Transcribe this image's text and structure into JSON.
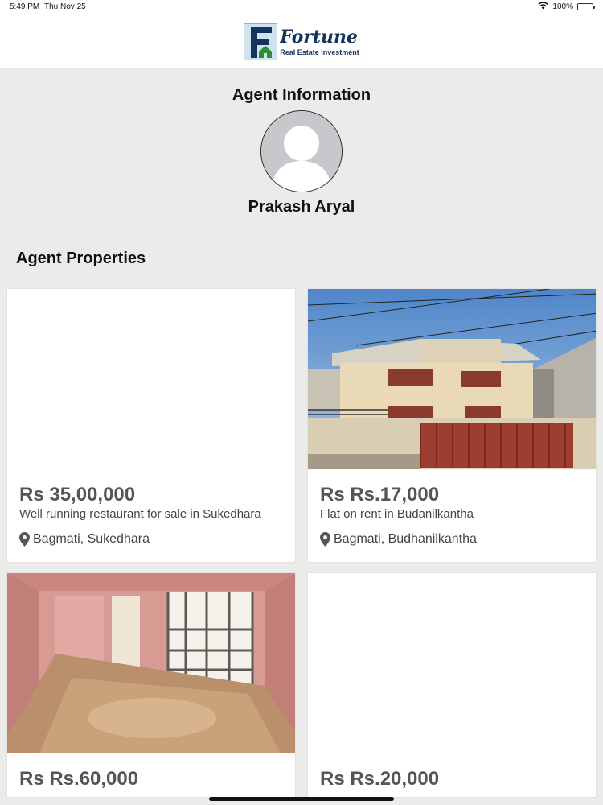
{
  "status_bar": {
    "time": "5:49 PM",
    "date": "Thu Nov 25",
    "battery": "100%",
    "battery_level": 1.0
  },
  "header": {
    "brand_name": "Fortune",
    "brand_tagline": "Real Estate Investment"
  },
  "agent": {
    "section_title": "Agent Information",
    "name": "Prakash Aryal"
  },
  "properties": {
    "section_title": "Agent Properties",
    "items": [
      {
        "price": "Rs 35,00,000",
        "title": "Well running restaurant for sale in Sukedhara",
        "location": "Bagmati, Sukedhara",
        "image": "blank"
      },
      {
        "price": "Rs Rs.17,000",
        "title": "Flat on rent in Budanilkantha",
        "location": "Bagmati, Budhanilkantha",
        "image": "house-photo"
      },
      {
        "price": "Rs Rs.60,000",
        "title": "",
        "location": "",
        "image": "room-photo"
      },
      {
        "price": "Rs Rs.20,000",
        "title": "",
        "location": "",
        "image": "blank"
      }
    ]
  },
  "colors": {
    "background": "#ebebea",
    "logo_navy": "#14345e",
    "logo_green": "#2f8a3a",
    "price_text": "#555555"
  }
}
